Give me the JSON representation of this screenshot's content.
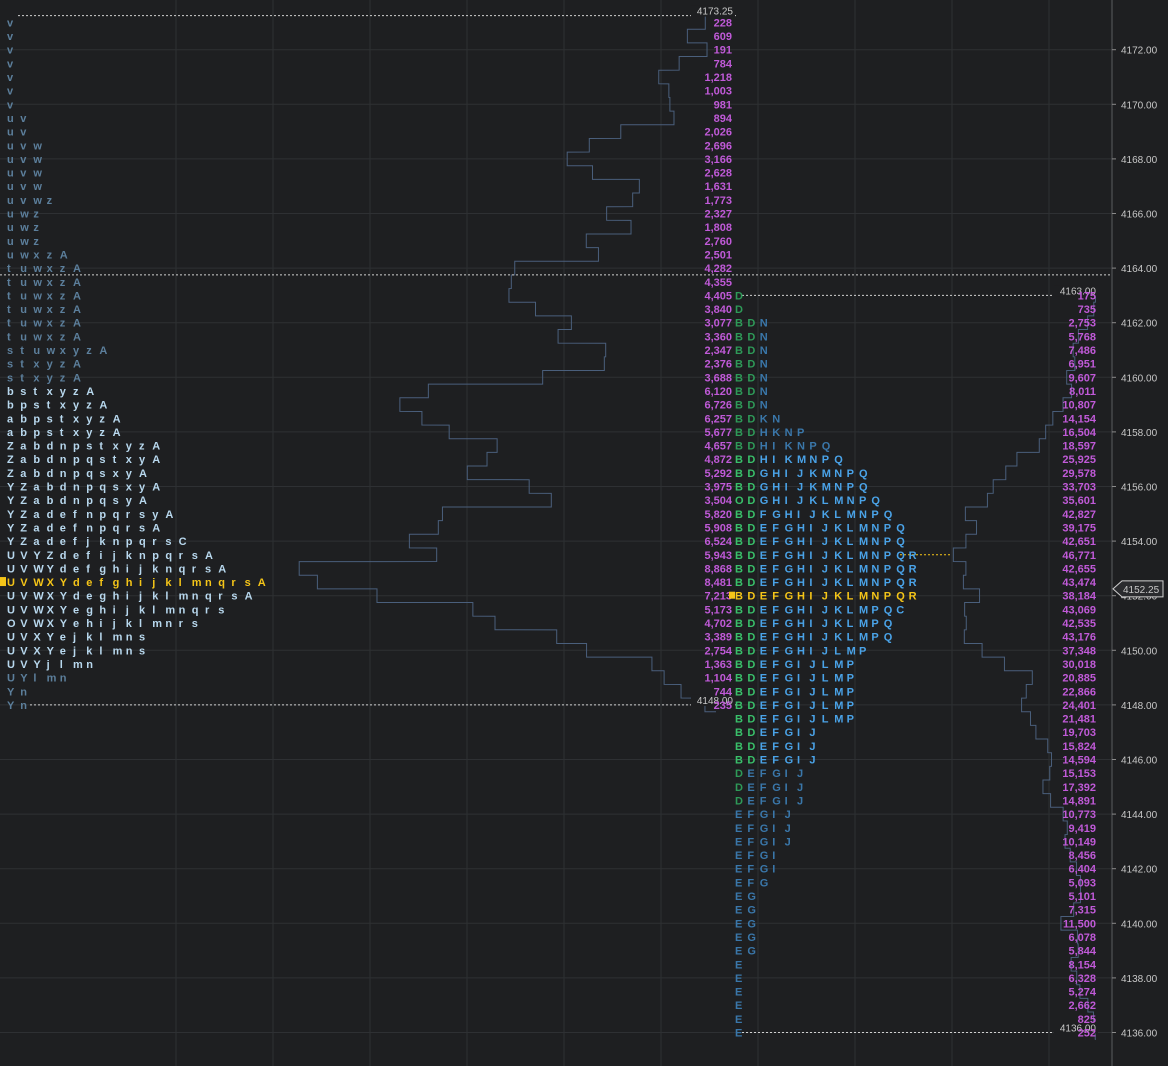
{
  "chart_data": {
    "type": "market-profile",
    "y_axis": {
      "range": [
        4135.5,
        4173.5
      ],
      "ticks": [
        "4136.00",
        "4138.00",
        "4140.00",
        "4142.00",
        "4144.00",
        "4146.00",
        "4148.00",
        "4150.00",
        "4152.00",
        "4154.00",
        "4156.00",
        "4158.00",
        "4160.00",
        "4162.00",
        "4164.00",
        "4166.00",
        "4168.00",
        "4170.00",
        "4172.00"
      ],
      "current_price": "4152.25",
      "current_price_value": 4152.25,
      "grid": true
    },
    "level_labels": {
      "p1_high": "4173.25",
      "p1_low": "4148.00",
      "p2_high": "4163.00",
      "p2_low": "4136.00"
    },
    "profile_1": {
      "rows": [
        {
          "price": 4173.0,
          "letters": "v",
          "volume": "228"
        },
        {
          "price": 4172.5,
          "letters": "v",
          "volume": "609"
        },
        {
          "price": 4172.0,
          "letters": "v",
          "volume": "191"
        },
        {
          "price": 4171.5,
          "letters": "v",
          "volume": "784"
        },
        {
          "price": 4171.0,
          "letters": "v",
          "volume": "1,218"
        },
        {
          "price": 4170.5,
          "letters": "v",
          "volume": "1,003"
        },
        {
          "price": 4170.0,
          "letters": "v",
          "volume": "981"
        },
        {
          "price": 4169.5,
          "letters": "uv",
          "volume": "894"
        },
        {
          "price": 4169.0,
          "letters": "uv",
          "volume": "2,026"
        },
        {
          "price": 4168.5,
          "letters": "uvw",
          "volume": "2,696"
        },
        {
          "price": 4168.0,
          "letters": "uvw",
          "volume": "3,166"
        },
        {
          "price": 4167.5,
          "letters": "uvw",
          "volume": "2,628"
        },
        {
          "price": 4167.0,
          "letters": "uvw",
          "volume": "1,631"
        },
        {
          "price": 4166.5,
          "letters": "uvwz",
          "volume": "1,773"
        },
        {
          "price": 4166.0,
          "letters": "uwz",
          "volume": "2,327"
        },
        {
          "price": 4165.5,
          "letters": "uwz",
          "volume": "1,808"
        },
        {
          "price": 4165.0,
          "letters": "uwz",
          "volume": "2,760"
        },
        {
          "price": 4164.5,
          "letters": "uwxzA",
          "volume": "2,501"
        },
        {
          "price": 4164.0,
          "letters": "tuwxzA",
          "volume": "4,282"
        },
        {
          "price": 4163.5,
          "letters": "tuwxzA",
          "volume": "4,355"
        },
        {
          "price": 4163.0,
          "letters": "tuwxzA",
          "volume": "4,405"
        },
        {
          "price": 4162.5,
          "letters": "tuwxzA",
          "volume": "3,840"
        },
        {
          "price": 4162.0,
          "letters": "tuwxzA",
          "volume": "3,077"
        },
        {
          "price": 4161.5,
          "letters": "tuwxzA",
          "volume": "3,360"
        },
        {
          "price": 4161.0,
          "letters": "stuwxyzA",
          "volume": "2,347"
        },
        {
          "price": 4160.5,
          "letters": "stxyzA",
          "volume": "2,376"
        },
        {
          "price": 4160.0,
          "letters": "stxyzA",
          "volume": "3,688"
        },
        {
          "price": 4159.5,
          "letters": "bstxyzA",
          "volume": "6,120"
        },
        {
          "price": 4159.0,
          "letters": "bpstxyzA",
          "volume": "6,726"
        },
        {
          "price": 4158.5,
          "letters": "abpstxyzA",
          "volume": "6,257"
        },
        {
          "price": 4158.0,
          "letters": "abpstxyzA",
          "volume": "5,677"
        },
        {
          "price": 4157.5,
          "letters": "ZabdnpstxyzA",
          "volume": "4,657"
        },
        {
          "price": 4157.0,
          "letters": "ZabdnpqstxyA",
          "volume": "4,872"
        },
        {
          "price": 4156.5,
          "letters": "ZabdnpqsxyA",
          "volume": "5,292"
        },
        {
          "price": 4156.0,
          "letters": "YZabdnpqsxyA",
          "volume": "3,975"
        },
        {
          "price": 4155.5,
          "letters": "YZabdnpqsyA",
          "volume": "3,504"
        },
        {
          "price": 4155.0,
          "letters": "YZadefnpqrsyA",
          "volume": "5,820"
        },
        {
          "price": 4154.5,
          "letters": "YZadefnpqrsA",
          "volume": "5,908"
        },
        {
          "price": 4154.0,
          "letters": "YZadefjknpqrsC",
          "volume": "6,524"
        },
        {
          "price": 4153.5,
          "letters": "UVYZdefijknpqrsA",
          "volume": "5,943"
        },
        {
          "price": 4153.0,
          "letters": "UVWYdefghijknqrsA",
          "volume": "8,868"
        },
        {
          "price": 4152.5,
          "letters": "UVWXYdefghijklmnqrsA",
          "volume": "8,481",
          "current": true
        },
        {
          "price": 4152.0,
          "letters": "UVWXYdeghijklmnqrsA",
          "volume": "7,213"
        },
        {
          "price": 4151.5,
          "letters": "UVWXYeghijklmnqrs",
          "volume": "5,173"
        },
        {
          "price": 4151.0,
          "letters": "OVWXYehijklmnrs",
          "volume": "4,702"
        },
        {
          "price": 4150.5,
          "letters": "UVXYejklmns",
          "volume": "3,389"
        },
        {
          "price": 4150.0,
          "letters": "UVXYejklmns",
          "volume": "2,754"
        },
        {
          "price": 4149.5,
          "letters": "UVYjlmn",
          "volume": "1,363"
        },
        {
          "price": 4149.0,
          "letters": "UYlmn",
          "volume": "1,104"
        },
        {
          "price": 4148.5,
          "letters": "Yn",
          "volume": "744"
        },
        {
          "price": 4148.0,
          "letters": "Yn",
          "volume": "235"
        }
      ]
    },
    "profile_2": {
      "rows": [
        {
          "price": 4163.0,
          "letters": "D",
          "volume": "175"
        },
        {
          "price": 4162.5,
          "letters": "D",
          "volume": "735"
        },
        {
          "price": 4162.0,
          "letters": "BDN",
          "volume": "2,753"
        },
        {
          "price": 4161.5,
          "letters": "BDN",
          "volume": "5,768"
        },
        {
          "price": 4161.0,
          "letters": "BDN",
          "volume": "7,486"
        },
        {
          "price": 4160.5,
          "letters": "BDN",
          "volume": "6,951"
        },
        {
          "price": 4160.0,
          "letters": "BDN",
          "volume": "9,607"
        },
        {
          "price": 4159.5,
          "letters": "BDN",
          "volume": "8,011"
        },
        {
          "price": 4159.0,
          "letters": "BDN",
          "volume": "10,807"
        },
        {
          "price": 4158.5,
          "letters": "BDKN",
          "volume": "14,154"
        },
        {
          "price": 4158.0,
          "letters": "BDHKNP",
          "volume": "16,504"
        },
        {
          "price": 4157.5,
          "letters": "BDHIKNPQ",
          "volume": "18,597"
        },
        {
          "price": 4157.0,
          "letters": "BDHIKMNPQ",
          "volume": "25,925"
        },
        {
          "price": 4156.5,
          "letters": "BDGHIJKMNPQ",
          "volume": "29,578"
        },
        {
          "price": 4156.0,
          "letters": "BDGHIJKMNPQ",
          "volume": "33,703"
        },
        {
          "price": 4155.5,
          "letters": "ODGHIJKLMNPQ",
          "volume": "35,601"
        },
        {
          "price": 4155.0,
          "letters": "BDFGHIJKLMNPQ",
          "volume": "42,827"
        },
        {
          "price": 4154.5,
          "letters": "BDEFGHIJKLMNPQ",
          "volume": "39,175"
        },
        {
          "price": 4154.0,
          "letters": "BDEFGHIJKLMNPQ",
          "volume": "42,651"
        },
        {
          "price": 4153.5,
          "letters": "BDEFGHIJKLMNPQR",
          "volume": "46,771"
        },
        {
          "price": 4153.0,
          "letters": "BDEFGHIJKLMNPQR",
          "volume": "42,655"
        },
        {
          "price": 4152.5,
          "letters": "BDEFGHIJKLMNPQR",
          "volume": "43,474"
        },
        {
          "price": 4152.0,
          "letters": "BDEFGHIJKLMNPQR",
          "volume": "38,184",
          "current": true
        },
        {
          "price": 4151.5,
          "letters": "BDEFGHIJKLMPQC",
          "volume": "43,069"
        },
        {
          "price": 4151.0,
          "letters": "BDEFGHIJKLMPQ",
          "volume": "42,535"
        },
        {
          "price": 4150.5,
          "letters": "BDEFGHIJKLMPQ",
          "volume": "43,176"
        },
        {
          "price": 4150.0,
          "letters": "BDEFGHIJLMP",
          "volume": "37,348"
        },
        {
          "price": 4149.5,
          "letters": "BDEFGIJLMP",
          "volume": "30,018"
        },
        {
          "price": 4149.0,
          "letters": "BDEFGIJLMP",
          "volume": "20,885"
        },
        {
          "price": 4148.5,
          "letters": "BDEFGIJLMP",
          "volume": "22,866"
        },
        {
          "price": 4148.0,
          "letters": "BDEFGIJLMP",
          "volume": "24,401"
        },
        {
          "price": 4147.5,
          "letters": "BDEFGIJLMP",
          "volume": "21,481"
        },
        {
          "price": 4147.0,
          "letters": "BDEFGIJ",
          "volume": "19,703"
        },
        {
          "price": 4146.5,
          "letters": "BDEFGIJ",
          "volume": "15,824"
        },
        {
          "price": 4146.0,
          "letters": "BDEFGIJ",
          "volume": "14,594"
        },
        {
          "price": 4145.5,
          "letters": "DEFGIJ",
          "volume": "15,153"
        },
        {
          "price": 4145.0,
          "letters": "DEFGIJ",
          "volume": "17,392"
        },
        {
          "price": 4144.5,
          "letters": "DEFGIJ",
          "volume": "14,891"
        },
        {
          "price": 4144.0,
          "letters": "EFGIJ",
          "volume": "10,773"
        },
        {
          "price": 4143.5,
          "letters": "EFGIJ",
          "volume": "9,419"
        },
        {
          "price": 4143.0,
          "letters": "EFGIJ",
          "volume": "10,149"
        },
        {
          "price": 4142.5,
          "letters": "EFGI",
          "volume": "8,456"
        },
        {
          "price": 4142.0,
          "letters": "EFGI",
          "volume": "6,404"
        },
        {
          "price": 4141.5,
          "letters": "EFG",
          "volume": "5,093"
        },
        {
          "price": 4141.0,
          "letters": "EG",
          "volume": "5,101"
        },
        {
          "price": 4140.5,
          "letters": "EG",
          "volume": "7,315"
        },
        {
          "price": 4140.0,
          "letters": "EG",
          "volume": "11,500"
        },
        {
          "price": 4139.5,
          "letters": "EG",
          "volume": "6,078"
        },
        {
          "price": 4139.0,
          "letters": "EG",
          "volume": "5,844"
        },
        {
          "price": 4138.5,
          "letters": "E",
          "volume": "8,154"
        },
        {
          "price": 4138.0,
          "letters": "E",
          "volume": "6,328"
        },
        {
          "price": 4137.5,
          "letters": "E",
          "volume": "5,274"
        },
        {
          "price": 4137.0,
          "letters": "E",
          "volume": "2,662"
        },
        {
          "price": 4136.5,
          "letters": "E",
          "volume": "825"
        },
        {
          "price": 4136.0,
          "letters": "E",
          "volume": "252"
        }
      ]
    },
    "colors": {
      "background": "#1e1f21",
      "grid": "#2e3033",
      "tpo_light": "#b8d8ee",
      "tpo_dim": "#5c7f9c",
      "tpo_current": "#f5c518",
      "tpo_green": "#39c06a",
      "tpo_blue": "#4aa3e8",
      "volume_text": "#c05ad8",
      "volume_outline": "#4a5f7c",
      "level_line": "#d0d0d0",
      "poc_line": "#f5c518",
      "axis_text": "#c8c8c8"
    }
  }
}
